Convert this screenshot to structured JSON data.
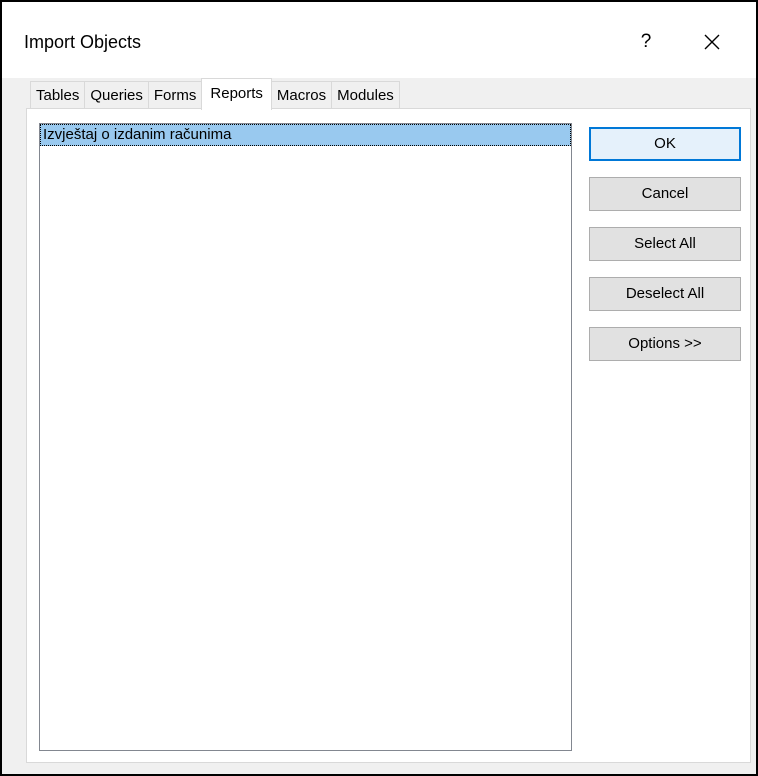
{
  "window": {
    "title": "Import Objects",
    "help_label": "?"
  },
  "tabs": [
    {
      "label": "Tables"
    },
    {
      "label": "Queries"
    },
    {
      "label": "Forms"
    },
    {
      "label": "Reports",
      "active": true
    },
    {
      "label": "Macros"
    },
    {
      "label": "Modules"
    }
  ],
  "list": {
    "items": [
      {
        "label": "Izvještaj o izdanim računima",
        "selected": true
      }
    ]
  },
  "buttons": {
    "ok": "OK",
    "cancel": "Cancel",
    "select_all": "Select All",
    "deselect_all": "Deselect All",
    "options": "Options >>"
  },
  "icons": {
    "close": "close-icon"
  },
  "colors": {
    "selection": "#99c9ef",
    "default_button_border": "#0078d7"
  }
}
